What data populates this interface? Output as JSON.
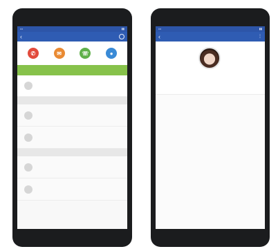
{
  "left": {
    "title": "",
    "actions": [
      {
        "color": "#e24b3c",
        "icon": "phone-icon"
      },
      {
        "color": "#e98a33",
        "icon": "mail-icon"
      },
      {
        "color": "#5fb04a",
        "icon": "chat-icon"
      },
      {
        "color": "#3a8ad6",
        "icon": "video-icon"
      }
    ],
    "green_bar": "",
    "contacts_top": [
      {
        "name": ""
      }
    ],
    "section_1": "",
    "contacts_mid": [
      {
        "name": ""
      },
      {
        "name": ""
      }
    ],
    "section_2": "",
    "contacts_bottom": [
      {
        "name": ""
      },
      {
        "name": ""
      }
    ]
  },
  "right": {
    "title": "",
    "profile_name": "",
    "profile_role": "",
    "profile_description": ""
  },
  "colors": {
    "appbar": "#2f5cb3",
    "accent_green": "#87c24b",
    "role_red": "#e53b3b"
  }
}
